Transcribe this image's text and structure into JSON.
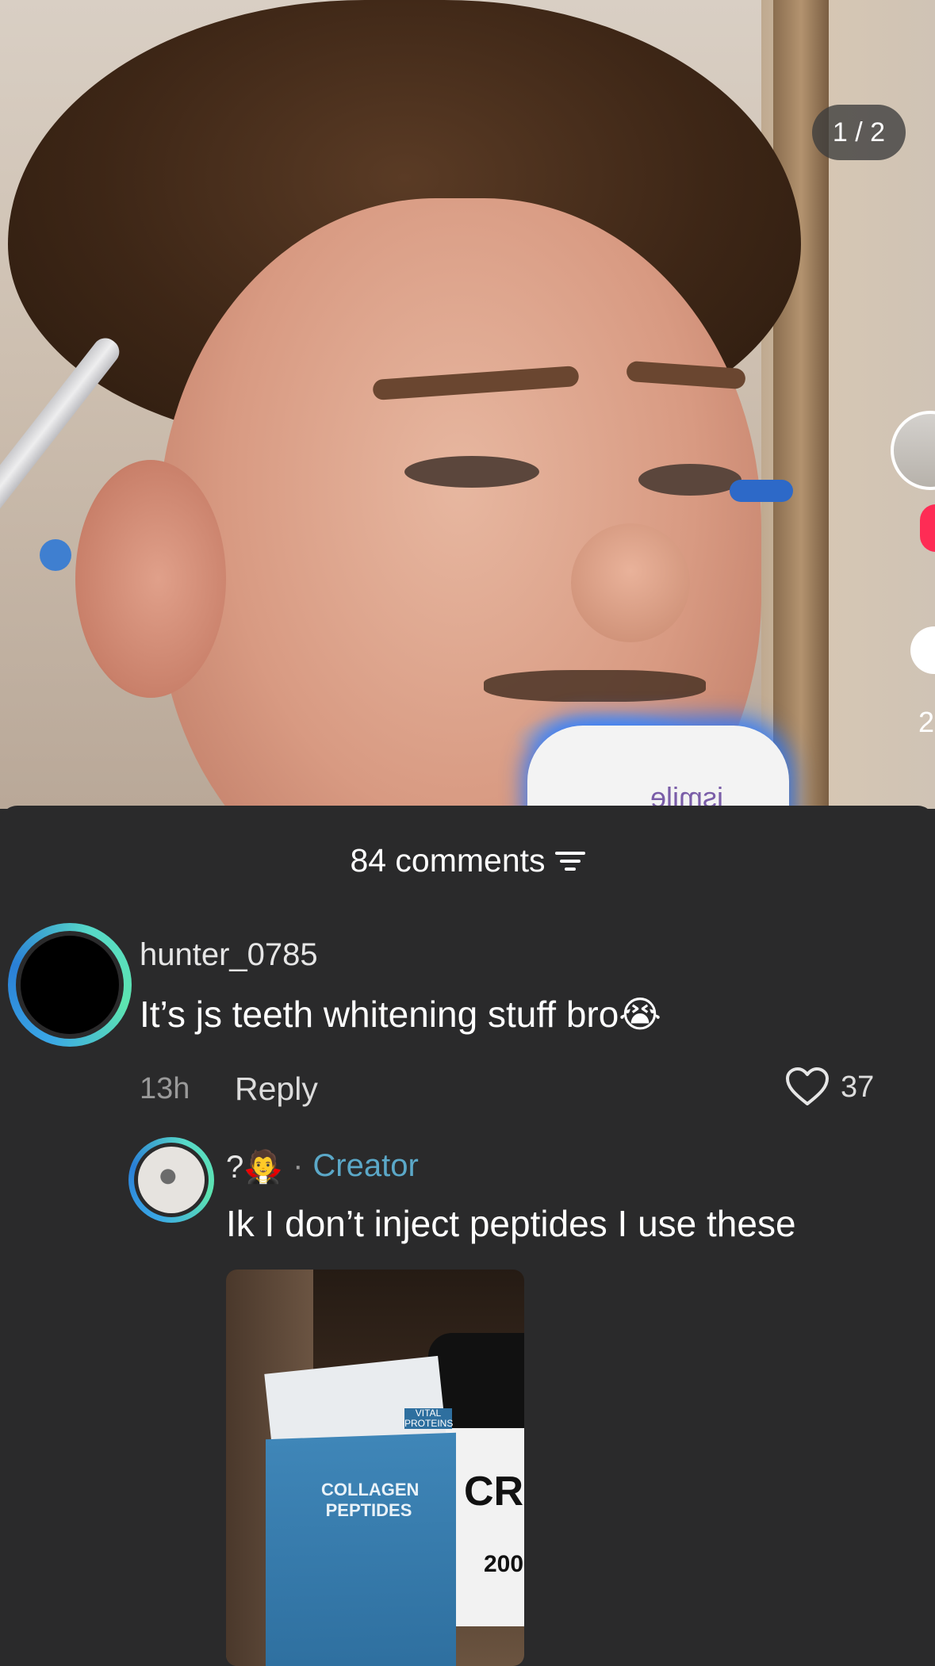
{
  "post": {
    "page_indicator": "1 / 2",
    "device_brand": "ismile",
    "side_count": "2"
  },
  "comments_header": {
    "title": "84 comments",
    "filter_icon": "filter-lines-icon"
  },
  "comments": [
    {
      "username": "hunter_0785",
      "text": "It’s js teeth whitening stuff bro😭",
      "time": "13h",
      "reply_label": "Reply",
      "likes": "37"
    }
  ],
  "reply": {
    "username": "?🧛",
    "separator": "·",
    "badge": "Creator",
    "text": "Ik I don’t inject peptides I use these",
    "photo": {
      "box_title": "COLLAGEN PEPTIDES",
      "box_brand": "VITAL PROTEINS",
      "jar_text": "CR",
      "jar_count": "200"
    }
  },
  "colors": {
    "sheet_bg": "#2a2a2b",
    "creator": "#5ba8c8",
    "ring_blue": "#3aa7e6",
    "ring_green": "#5de4b0"
  }
}
